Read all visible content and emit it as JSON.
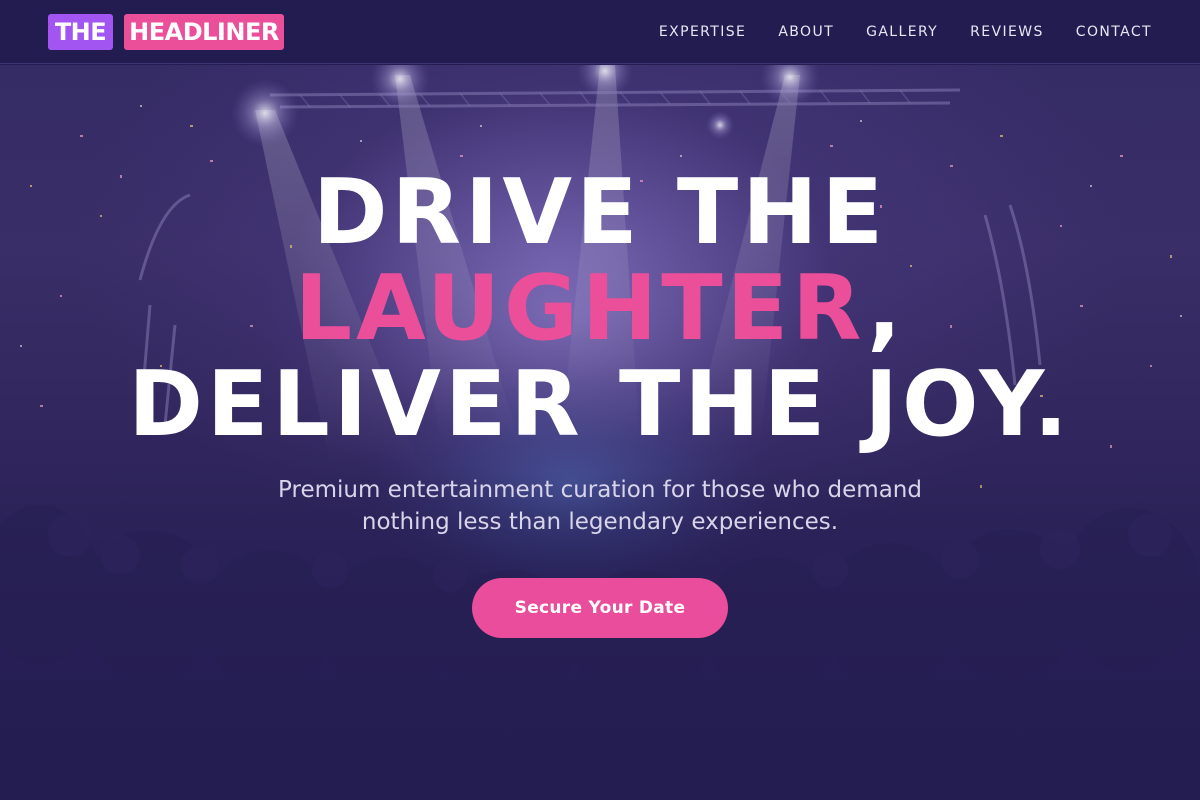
{
  "brand": {
    "logo_part1": "THE",
    "logo_part2": "HEADLINER"
  },
  "nav": {
    "items": [
      {
        "label": "EXPERTISE"
      },
      {
        "label": "ABOUT"
      },
      {
        "label": "GALLERY"
      },
      {
        "label": "REVIEWS"
      },
      {
        "label": "CONTACT"
      }
    ]
  },
  "hero": {
    "headline_line1": "DRIVE THE",
    "headline_accent": "LAUGHTER",
    "headline_comma": ",",
    "headline_line3": "DELIVER THE JOY.",
    "subtext": "Premium entertainment curation for those who demand nothing less than legendary experiences.",
    "cta_label": "Secure Your Date",
    "background": "concert-crowd-stage-photo"
  },
  "colors": {
    "navbar_bg": "#221c50",
    "page_bg": "#241d52",
    "logo_the_bg": "#a255f0",
    "logo_headliner_bg": "#ec4f9a",
    "accent_pink": "#ec4f9a",
    "cta_bg": "#e94d9b",
    "text_white": "#ffffff",
    "subtext": "#d8d4ea"
  }
}
